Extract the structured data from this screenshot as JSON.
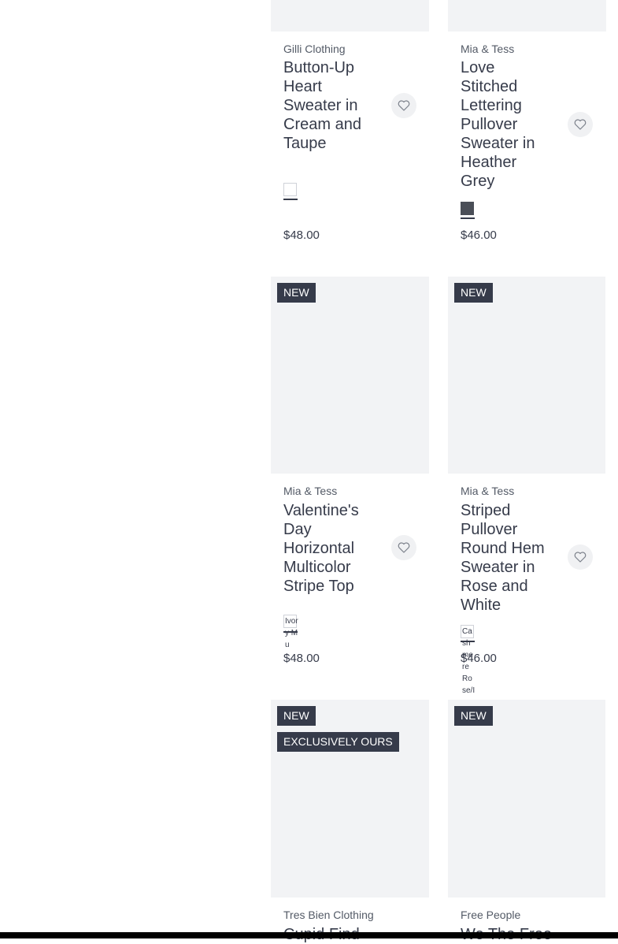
{
  "products": [
    {
      "brand": "Gilli Clothing",
      "title": "Button-Up Heart Sweater in Cream and Taupe",
      "price": "$48.00",
      "badges": [],
      "swatch": {
        "color": "#ffffff",
        "label": ""
      }
    },
    {
      "brand": "Mia & Tess",
      "title": "Love Stitched Lettering Pullover Sweater in Heather Grey",
      "price": "$46.00",
      "badges": [],
      "swatch": {
        "color": "#4a4e57",
        "label": ""
      }
    },
    {
      "brand": "Mia & Tess",
      "title": "Valentine's Day Horizontal Multicolor Stripe Top",
      "price": "$48.00",
      "badges": [
        "NEW"
      ],
      "swatch": {
        "color": "#ffffff",
        "label": "Ivory Mu"
      }
    },
    {
      "brand": "Mia & Tess",
      "title": "Striped Pullover Round Hem Sweater in Rose and White",
      "price": "$46.00",
      "badges": [
        "NEW"
      ],
      "swatch": {
        "color": "#ffffff",
        "label": "Cashmere Rose/Ivor"
      }
    },
    {
      "brand": "Tres Bien Clothing",
      "title": "Cupid Find",
      "price": "",
      "badges": [
        "NEW",
        "EXCLUSIVELY OURS"
      ],
      "swatch": {
        "color": "#ffffff",
        "label": ""
      }
    },
    {
      "brand": "Free People",
      "title": "We The Free",
      "price": "",
      "badges": [
        "NEW"
      ],
      "swatch": {
        "color": "#ffffff",
        "label": ""
      }
    }
  ]
}
